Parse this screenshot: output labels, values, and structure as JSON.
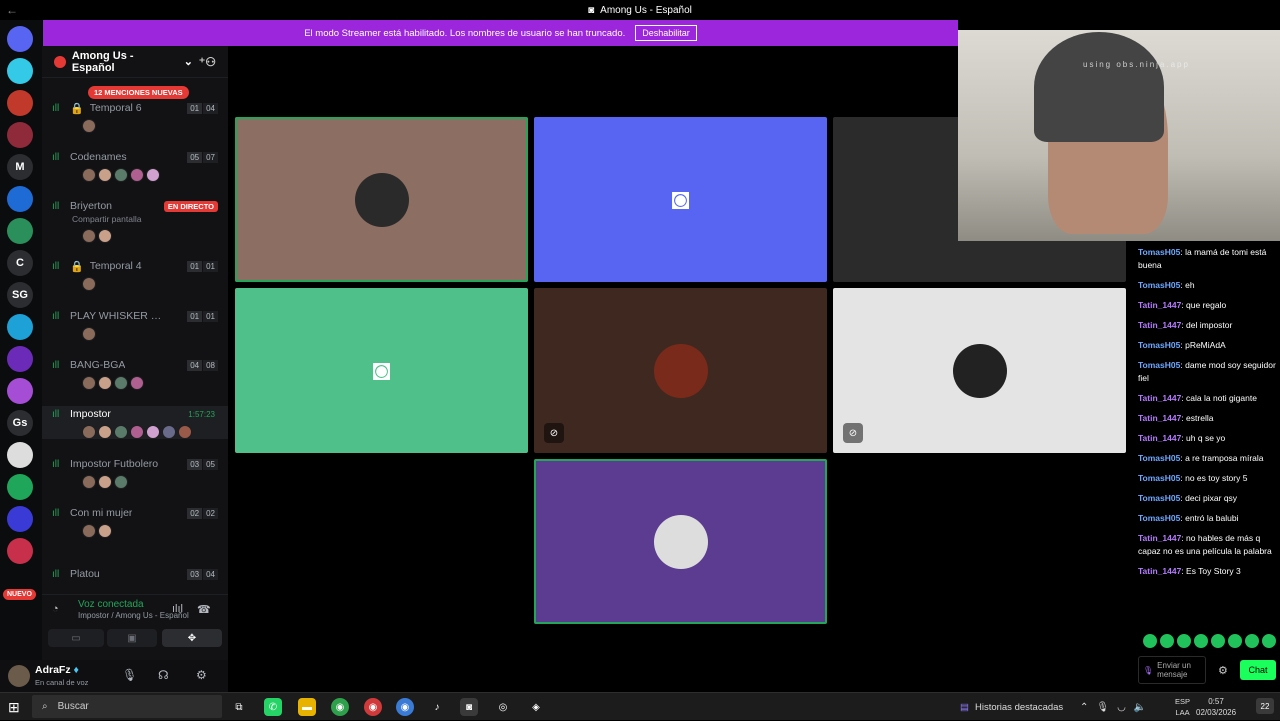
{
  "window": {
    "title": "Among Us - Español"
  },
  "banner": {
    "text": "El modo Streamer está habilitado. Los nombres de usuario se han truncado.",
    "button": "Deshabilitar"
  },
  "servers": [
    {
      "label": "",
      "badge": "2",
      "color": "#5865f2"
    },
    {
      "label": "",
      "badge": "2",
      "color": "#35c9e8"
    },
    {
      "label": "",
      "badge": "55",
      "color": "#c0392b"
    },
    {
      "label": "",
      "badge": "",
      "color": "#8e2a3a"
    },
    {
      "label": "M",
      "badge": "",
      "color": "#2b2d31"
    },
    {
      "label": "",
      "badge": "2",
      "color": "#1e6bd6"
    },
    {
      "label": "",
      "badge": "12",
      "color": "#2a8f5a"
    },
    {
      "label": "C",
      "badge": "",
      "color": "#2b2d31"
    },
    {
      "label": "SG",
      "badge": "",
      "color": "#2b2d31"
    },
    {
      "label": "",
      "badge": "7K+",
      "color": "#1da1d6"
    },
    {
      "label": "",
      "badge": "71",
      "color": "#6b2bb8"
    },
    {
      "label": "",
      "badge": "4",
      "color": "#a64dd6"
    },
    {
      "label": "Gs",
      "badge": "",
      "color": "#2b2d31"
    },
    {
      "label": "",
      "badge": "11",
      "color": "#ddd"
    },
    {
      "label": "",
      "badge": "165",
      "color": "#1fa65a"
    },
    {
      "label": "",
      "badge": "",
      "color": "#3a3ad6"
    },
    {
      "label": "",
      "badge": "282",
      "color": "#c72f4a"
    }
  ],
  "servers_new": "NUEVO",
  "guild": {
    "name": "Among Us - Español",
    "mentions": "12 MENCIONES NUEVAS"
  },
  "channels": [
    {
      "name": "Temporal 6",
      "locked": true,
      "a": "01",
      "b": "04",
      "avatars": 1
    },
    {
      "name": "Codenames",
      "a": "05",
      "b": "07",
      "avatars": 5
    },
    {
      "name": "Briyerton",
      "live": "EN DIRECTO",
      "sub": "Compartir pantalla",
      "avatars": 2
    },
    {
      "name": "Temporal 4",
      "locked": true,
      "a": "01",
      "b": "01",
      "avatars": 1
    },
    {
      "name": "PLAY WHISKER W...",
      "a": "01",
      "b": "01",
      "avatars": 1
    },
    {
      "name": "BANG-BGA",
      "a": "04",
      "b": "08",
      "avatars": 4
    },
    {
      "name": "Impostor",
      "time": "1:57:23",
      "avatars": 7
    },
    {
      "name": "Impostor Futbolero",
      "a": "03",
      "b": "05",
      "avatars": 3
    },
    {
      "name": "Con mi mujer",
      "a": "02",
      "b": "02",
      "avatars": 2
    },
    {
      "name": "Platou",
      "a": "03",
      "b": "04",
      "avatars": 0
    }
  ],
  "voice": {
    "status": "Voz conectada",
    "where": "Impostor / Among Us - Español"
  },
  "user": {
    "name": "AdraFz",
    "status": "En canal de voz"
  },
  "tiles": [
    {
      "bg": "#8c6e63",
      "speaking": true,
      "mute": false,
      "avatar": "#2a2a2a"
    },
    {
      "bg": "#5865f2",
      "discord_logo": true
    },
    {
      "bg": "#2b2b2b"
    },
    {
      "bg": "#4fc08a",
      "discord_logo": true
    },
    {
      "bg": "#3e2820",
      "mute": true,
      "avatar": "#7a2a1a"
    },
    {
      "bg": "#e4e4e4",
      "mute": true,
      "avatar": "#222"
    },
    {
      "bg": "#5b3c91",
      "speaking": true,
      "avatar": "#ddd"
    }
  ],
  "webcam": {
    "watermark": "using obs.ninja.app"
  },
  "chat": [
    {
      "user": "TomasH05",
      "text": "la mamá de tomi está buena",
      "c": "u1"
    },
    {
      "user": "TomasH05",
      "text": "eh",
      "c": "u1"
    },
    {
      "user": "Tatin_1447",
      "text": "que regalo",
      "c": "u2"
    },
    {
      "user": "Tatin_1447",
      "text": "del impostor",
      "c": "u2"
    },
    {
      "user": "TomasH05",
      "text": "pReMiAdA",
      "c": "u1"
    },
    {
      "user": "TomasH05",
      "text": "dame mod soy seguidor fiel",
      "c": "u1"
    },
    {
      "user": "Tatin_1447",
      "text": "cala la noti gigante",
      "c": "u2"
    },
    {
      "user": "Tatin_1447",
      "text": "estrella",
      "c": "u2"
    },
    {
      "user": "Tatin_1447",
      "text": "uh q se yo",
      "c": "u2"
    },
    {
      "user": "TomasH05",
      "text": "a re tramposa mírala",
      "c": "u1"
    },
    {
      "user": "TomasH05",
      "text": "no es toy story 5",
      "c": "u1"
    },
    {
      "user": "TomasH05",
      "text": "deci pixar qsy",
      "c": "u1"
    },
    {
      "user": "TomasH05",
      "text": "entró la balubi",
      "c": "u1"
    },
    {
      "user": "Tatin_1447",
      "text": "no hables de más q capaz no es una película la palabra",
      "c": "u2"
    },
    {
      "user": "Tatin_1447",
      "text": "Es Toy Story 3",
      "c": "u2"
    }
  ],
  "chat_input": {
    "placeholder": "Enviar un mensaje",
    "send": "Chat"
  },
  "taskbar": {
    "search": "Buscar",
    "stories": "Historias destacadas",
    "lang1": "ESP",
    "lang2": "LAA",
    "time": "0:57",
    "date": "02/03/2026",
    "notif": "22"
  }
}
